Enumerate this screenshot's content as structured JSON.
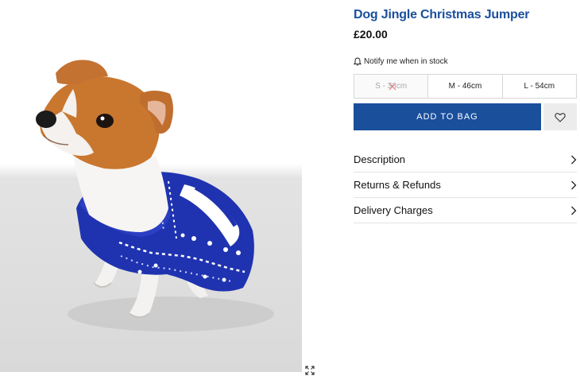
{
  "product": {
    "title": "Dog Jingle Christmas Jumper",
    "price": "£20.00",
    "notify_label": "Notify me when in stock",
    "image_icon": "expand-icon"
  },
  "sizes": [
    {
      "label": "S - 36cm",
      "available": false
    },
    {
      "label": "M - 46cm",
      "available": true
    },
    {
      "label": "L - 54cm",
      "available": true
    }
  ],
  "actions": {
    "add_to_bag": "ADD TO BAG",
    "wishlist_icon": "heart-icon"
  },
  "accordion": [
    {
      "label": "Description",
      "icon": "chevron-right-icon"
    },
    {
      "label": "Returns & Refunds",
      "icon": "chevron-right-icon"
    },
    {
      "label": "Delivery Charges",
      "icon": "chevron-right-icon"
    }
  ],
  "colors": {
    "brand_blue": "#1a4f9c",
    "jumper_blue": "#1f33b0",
    "border": "#d7d7d7"
  }
}
